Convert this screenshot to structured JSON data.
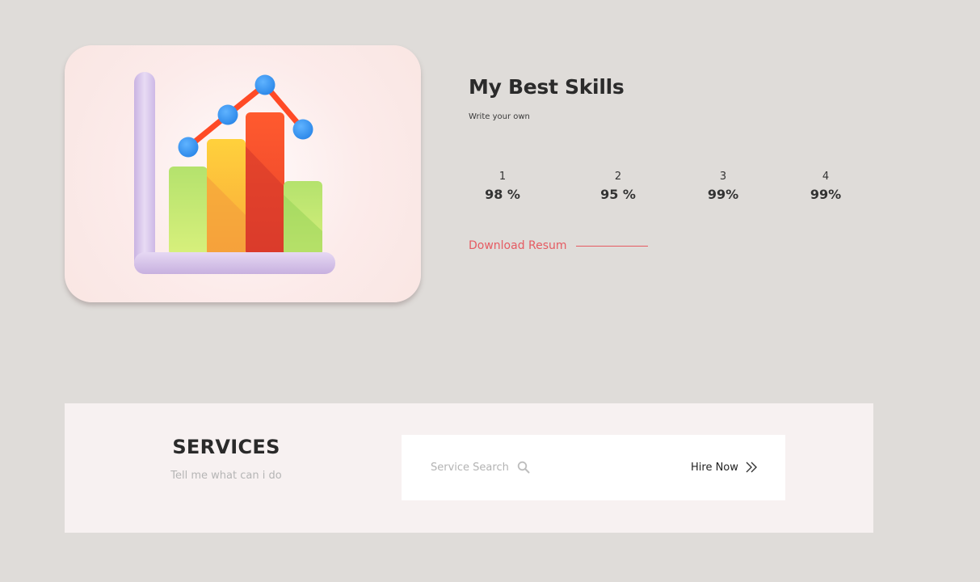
{
  "skills": {
    "title": "My Best Skills",
    "subtitle": "Write your own",
    "stats": [
      {
        "num": "1",
        "value": "98 %"
      },
      {
        "num": "2",
        "value": "95 %"
      },
      {
        "num": "3",
        "value": "99%"
      },
      {
        "num": "4",
        "value": "99%"
      }
    ],
    "download_label": "Download Resum",
    "accent_color": "#e55b62"
  },
  "illustration": {
    "icon": "bar-chart-icon"
  },
  "services": {
    "title": "SERVICES",
    "subtitle": "Tell me what can i do",
    "search_placeholder": "Service Search",
    "hire_label": "Hire Now"
  }
}
